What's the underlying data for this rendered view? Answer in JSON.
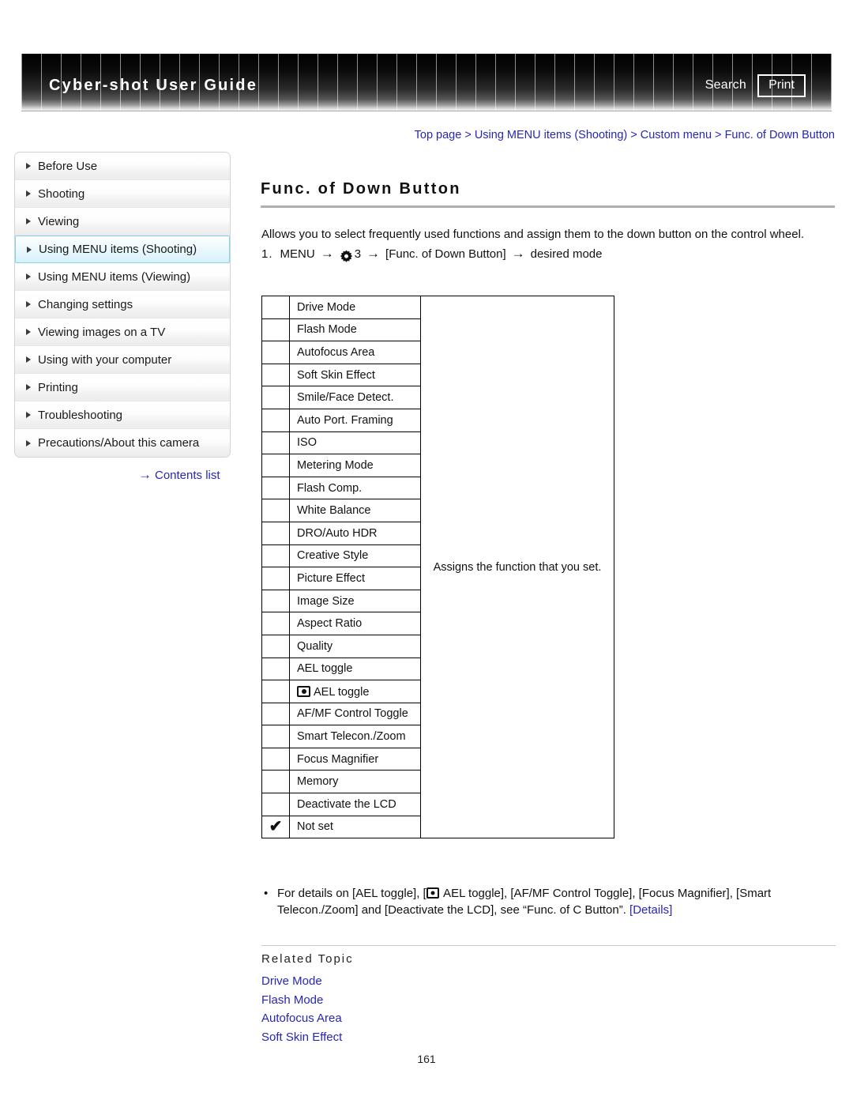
{
  "header": {
    "title": "Cyber-shot User Guide",
    "search_label": "Search",
    "print_label": "Print"
  },
  "breadcrumb": {
    "items": [
      "Top page",
      "Using MENU items (Shooting)",
      "Custom menu",
      "Func. of Down Button"
    ],
    "separator": " > ",
    "full": "Top page > Using MENU items (Shooting) > Custom menu > Func. of Down Button"
  },
  "sidebar": {
    "items": [
      {
        "label": "Before Use",
        "selected": false
      },
      {
        "label": "Shooting",
        "selected": false
      },
      {
        "label": "Viewing",
        "selected": false
      },
      {
        "label": "Using MENU items (Shooting)",
        "selected": true
      },
      {
        "label": "Using MENU items (Viewing)",
        "selected": false
      },
      {
        "label": "Changing settings",
        "selected": false
      },
      {
        "label": "Viewing images on a TV",
        "selected": false
      },
      {
        "label": "Using with your computer",
        "selected": false
      },
      {
        "label": "Printing",
        "selected": false
      },
      {
        "label": "Troubleshooting",
        "selected": false
      },
      {
        "label": "Precautions/About this camera",
        "selected": false
      }
    ],
    "contents_link": "Contents list",
    "contents_arrow": "→"
  },
  "main": {
    "title": "Func. of Down Button",
    "intro": "Allows you to select frequently used functions and assign them to the down button on the control wheel.",
    "step": {
      "number": "1.",
      "part1": "MENU",
      "arrow": "→",
      "gear_label": "3",
      "part2": "[Func. of Down Button]",
      "part3": "desired mode"
    },
    "table": {
      "description": "Assigns the function that you set.",
      "check_glyph": "✔",
      "rows": [
        {
          "name": "Drive Mode",
          "checked": false,
          "icon": null
        },
        {
          "name": "Flash Mode",
          "checked": false,
          "icon": null
        },
        {
          "name": "Autofocus Area",
          "checked": false,
          "icon": null
        },
        {
          "name": "Soft Skin Effect",
          "checked": false,
          "icon": null
        },
        {
          "name": "Smile/Face Detect.",
          "checked": false,
          "icon": null
        },
        {
          "name": "Auto Port. Framing",
          "checked": false,
          "icon": null
        },
        {
          "name": "ISO",
          "checked": false,
          "icon": null
        },
        {
          "name": "Metering Mode",
          "checked": false,
          "icon": null
        },
        {
          "name": "Flash Comp.",
          "checked": false,
          "icon": null
        },
        {
          "name": "White Balance",
          "checked": false,
          "icon": null
        },
        {
          "name": "DRO/Auto HDR",
          "checked": false,
          "icon": null
        },
        {
          "name": "Creative Style",
          "checked": false,
          "icon": null
        },
        {
          "name": "Picture Effect",
          "checked": false,
          "icon": null
        },
        {
          "name": "Image Size",
          "checked": false,
          "icon": null
        },
        {
          "name": "Aspect Ratio",
          "checked": false,
          "icon": null
        },
        {
          "name": "Quality",
          "checked": false,
          "icon": null
        },
        {
          "name": "AEL toggle",
          "checked": false,
          "icon": null
        },
        {
          "name": "AEL toggle",
          "checked": false,
          "icon": "spot-meter-icon"
        },
        {
          "name": "AF/MF Control Toggle",
          "checked": false,
          "icon": null
        },
        {
          "name": "Smart Telecon./Zoom",
          "checked": false,
          "icon": null
        },
        {
          "name": "Focus Magnifier",
          "checked": false,
          "icon": null
        },
        {
          "name": "Memory",
          "checked": false,
          "icon": null
        },
        {
          "name": "Deactivate the LCD",
          "checked": false,
          "icon": null
        },
        {
          "name": "Not set",
          "checked": true,
          "icon": null
        }
      ]
    },
    "note": {
      "bullet": "•",
      "text_before_icon": "For details on [AEL toggle], [",
      "text_after_icon": " AEL toggle], [AF/MF Control Toggle], [Focus Magnifier], [Smart Telecon./Zoom] and [Deactivate the LCD], see “Func. of C Button”. ",
      "details_link": "[Details]"
    },
    "related": {
      "heading": "Related Topic",
      "links": [
        "Drive Mode",
        "Flash Mode",
        "Autofocus Area",
        "Soft Skin Effect"
      ]
    }
  },
  "footer": {
    "page_number": "161"
  },
  "colors": {
    "link": "#2626b8",
    "selected_border": "#7fd4ee",
    "selected_bg": "#d6f1fa",
    "header_text": "#ffffff"
  }
}
